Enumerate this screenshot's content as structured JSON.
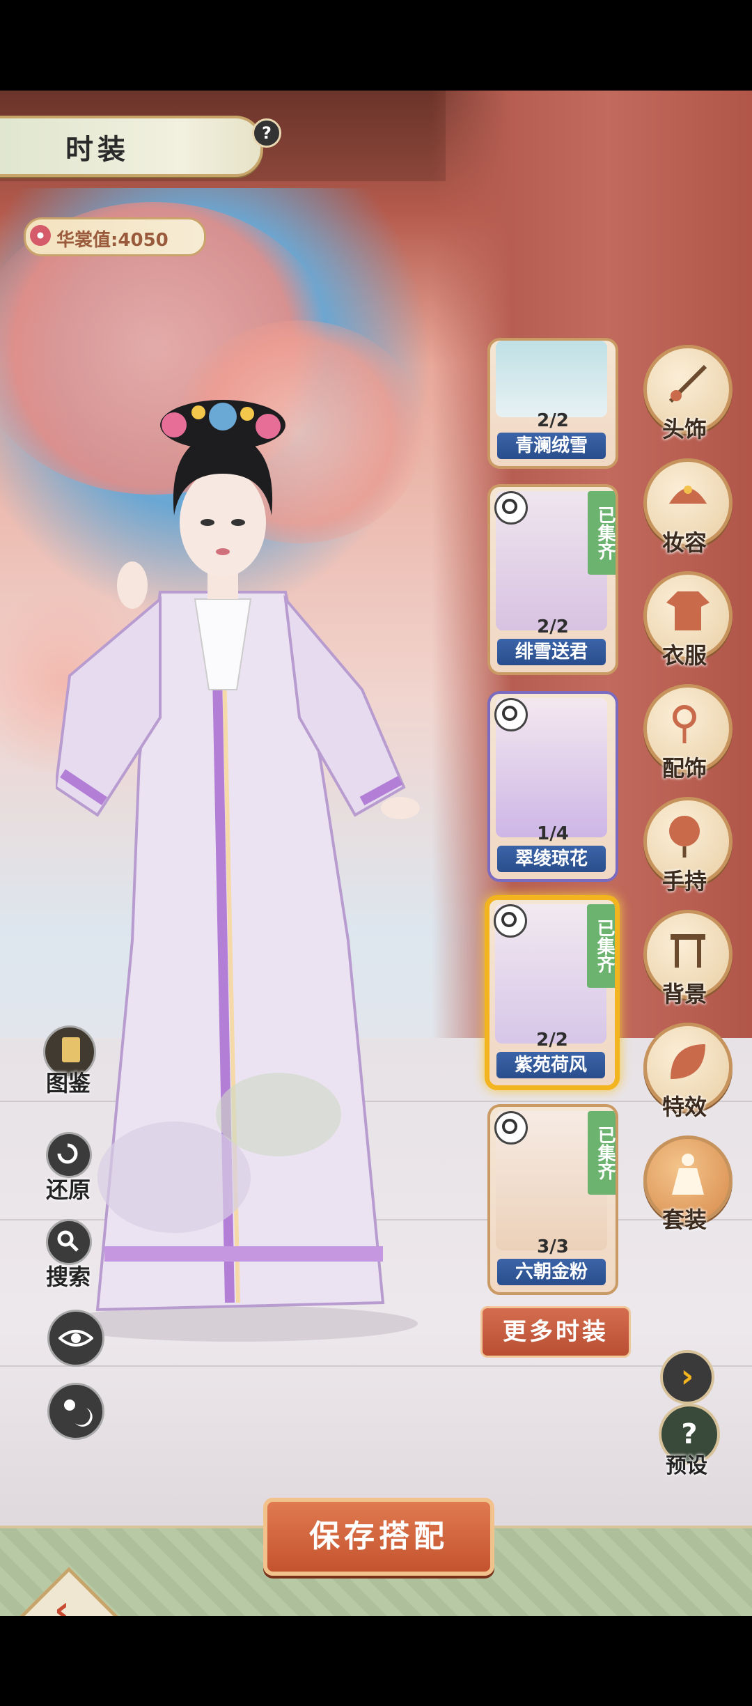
{
  "header": {
    "title": "时装",
    "help_label": "?"
  },
  "score": {
    "label": "华裳值:4050"
  },
  "outfits": [
    {
      "count": "2/2",
      "name": "青澜绒雪",
      "collected": false,
      "selected": false
    },
    {
      "count": "2/2",
      "name": "绯雪送君",
      "collected": true,
      "collected_label": "已集齐",
      "selected": false
    },
    {
      "count": "1/4",
      "name": "翠绫琼花",
      "collected": false,
      "selected": false
    },
    {
      "count": "2/2",
      "name": "紫苑荷风",
      "collected": true,
      "collected_label": "已集齐",
      "selected": true
    },
    {
      "count": "3/3",
      "name": "六朝金粉",
      "collected": true,
      "collected_label": "已集齐",
      "selected": false
    }
  ],
  "more_label": "更多时装",
  "categories": [
    {
      "label": "头饰",
      "icon": "hairpin-icon"
    },
    {
      "label": "妆容",
      "icon": "headdress-icon"
    },
    {
      "label": "衣服",
      "icon": "robe-icon"
    },
    {
      "label": "配饰",
      "icon": "pendant-icon"
    },
    {
      "label": "手持",
      "icon": "fan-icon"
    },
    {
      "label": "背景",
      "icon": "pavilion-icon"
    },
    {
      "label": "特效",
      "icon": "leaf-icon"
    },
    {
      "label": "套装",
      "icon": "outfit-icon",
      "active": true
    }
  ],
  "preset": {
    "label": "预设",
    "icon": "question-icon"
  },
  "next_icon": "chevron-right-icon",
  "tools": {
    "catalog": "图鉴",
    "restore": "还原",
    "search": "搜索",
    "view_icon": "eye-icon",
    "light_icon": "sun-moon-icon"
  },
  "save_label": "保存搭配",
  "back_icon": "back-arrow-icon"
}
